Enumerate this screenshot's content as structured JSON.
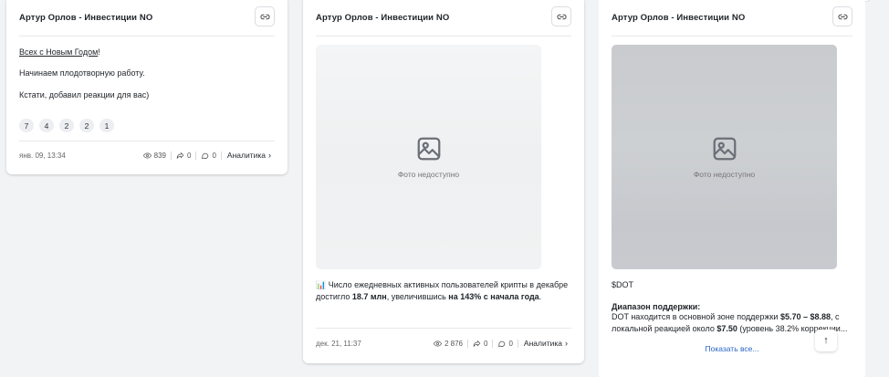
{
  "posts": [
    {
      "channel": "Артур Орлов - Инвестиции NO",
      "lines": {
        "link_text": "Всех с Новым Годом",
        "line1_suffix": "!",
        "line2": "Начинаем плодотворную работу.",
        "line3": "Кстати, добавил реакции для вас)"
      },
      "reactions": [
        "7",
        "4",
        "2",
        "2",
        "1"
      ],
      "date": "янв. 09, 13:34",
      "views": "839",
      "shares": "0",
      "comments": "0",
      "analytics_label": "Аналитика"
    },
    {
      "channel": "Артур Орлов - Инвестиции NO",
      "photo_label": "Фото недоступно",
      "text": {
        "emoji": "📊",
        "part1": " Число ежедневных активных пользователей крипты в декабре достигло ",
        "bold1": "18.7 млн",
        "part2": ", увеличившись ",
        "bold2": "на 143% с начала года",
        "part3": "."
      },
      "date": "дек. 21, 11:37",
      "views": "2 876",
      "shares": "0",
      "comments": "0",
      "analytics_label": "Аналитика"
    },
    {
      "channel": "Артур Орлов - Инвестиции NO",
      "photo_label": "Фото недоступно",
      "ticker": "$DOT",
      "section_title": "Диапазон поддержки:",
      "text": {
        "part1": "DOT находится в основной зоне поддержки ",
        "bold1": "$5.70 – $8.88",
        "part2": ", с локальной реакцией около ",
        "bold2": "$7.50",
        "part3": " (уровень 38.2% коррекции..."
      },
      "show_more": "Показать все..."
    }
  ],
  "scroll_top_icon": "arrow-up-icon"
}
